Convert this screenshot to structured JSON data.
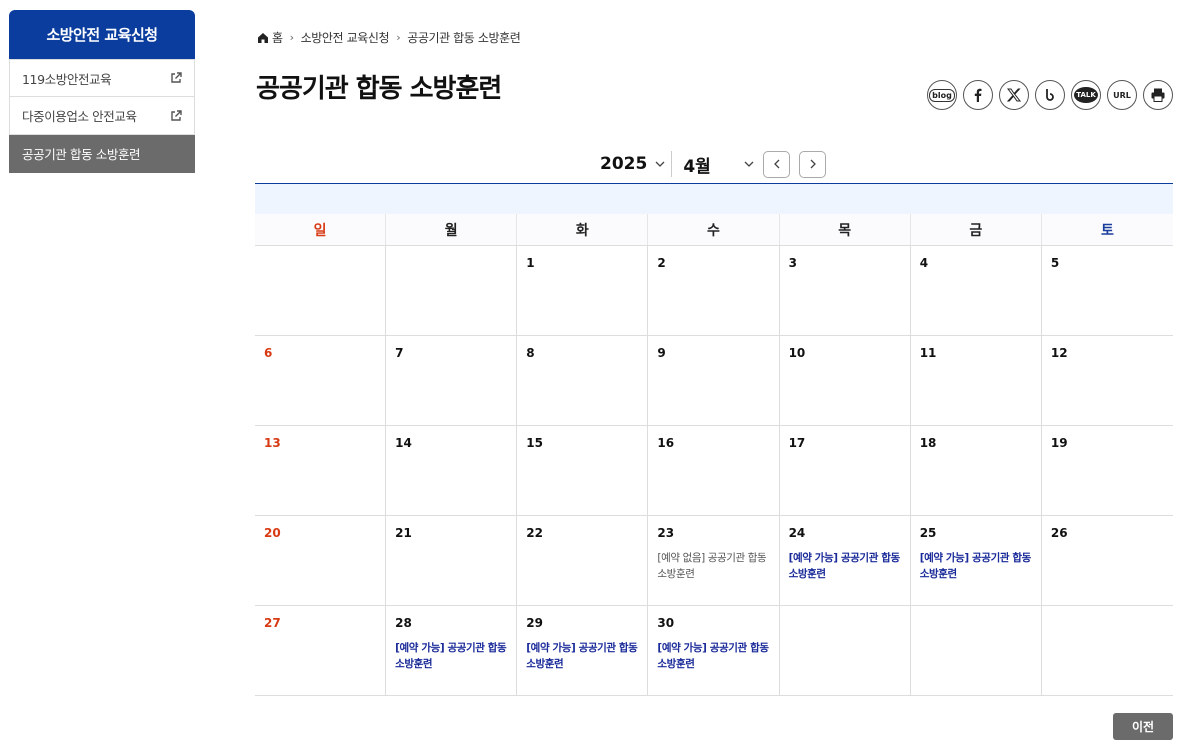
{
  "sidebar": {
    "title": "소방안전 교육신청",
    "items": [
      {
        "label": "119소방안전교육",
        "external": true
      },
      {
        "label": "다중이용업소 안전교육",
        "external": true
      },
      {
        "label": "공공기관 합동 소방훈련",
        "external": false
      }
    ]
  },
  "breadcrumb": [
    "홈",
    "소방안전 교육신청",
    "공공기관 합동 소방훈련"
  ],
  "page_title": "공공기관 합동 소방훈련",
  "share": {
    "blog": "blog",
    "talk": "TALK",
    "url": "URL"
  },
  "calendar": {
    "year": "2025",
    "month": "4월",
    "weekdays": [
      "일",
      "월",
      "화",
      "수",
      "목",
      "금",
      "토"
    ],
    "weeks": [
      [
        {
          "d": ""
        },
        {
          "d": ""
        },
        {
          "d": "1"
        },
        {
          "d": "2"
        },
        {
          "d": "3"
        },
        {
          "d": "4"
        },
        {
          "d": "5"
        }
      ],
      [
        {
          "d": "6"
        },
        {
          "d": "7"
        },
        {
          "d": "8"
        },
        {
          "d": "9"
        },
        {
          "d": "10"
        },
        {
          "d": "11"
        },
        {
          "d": "12"
        }
      ],
      [
        {
          "d": "13"
        },
        {
          "d": "14"
        },
        {
          "d": "15"
        },
        {
          "d": "16"
        },
        {
          "d": "17"
        },
        {
          "d": "18"
        },
        {
          "d": "19"
        }
      ],
      [
        {
          "d": "20"
        },
        {
          "d": "21"
        },
        {
          "d": "22"
        },
        {
          "d": "23",
          "event": "[예약 없음] 공공기관 합동 소방훈련",
          "status": "none"
        },
        {
          "d": "24",
          "event": "[예약 가능] 공공기관 합동 소방훈련",
          "status": "available"
        },
        {
          "d": "25",
          "event": "[예약 가능] 공공기관 합동 소방훈련",
          "status": "available"
        },
        {
          "d": "26"
        }
      ],
      [
        {
          "d": "27"
        },
        {
          "d": "28",
          "event": "[예약 가능] 공공기관 합동 소방훈련",
          "status": "available"
        },
        {
          "d": "29",
          "event": "[예약 가능] 공공기관 합동 소방훈련",
          "status": "available"
        },
        {
          "d": "30",
          "event": "[예약 가능] 공공기관 합동 소방훈련",
          "status": "available"
        },
        {
          "d": ""
        },
        {
          "d": ""
        },
        {
          "d": ""
        }
      ]
    ]
  },
  "prev_label": "이전",
  "colors": {
    "brand": "#0a3d9e",
    "sunday": "#d83a14",
    "saturday": "#1a3e9c",
    "available": "#1a2b99"
  }
}
